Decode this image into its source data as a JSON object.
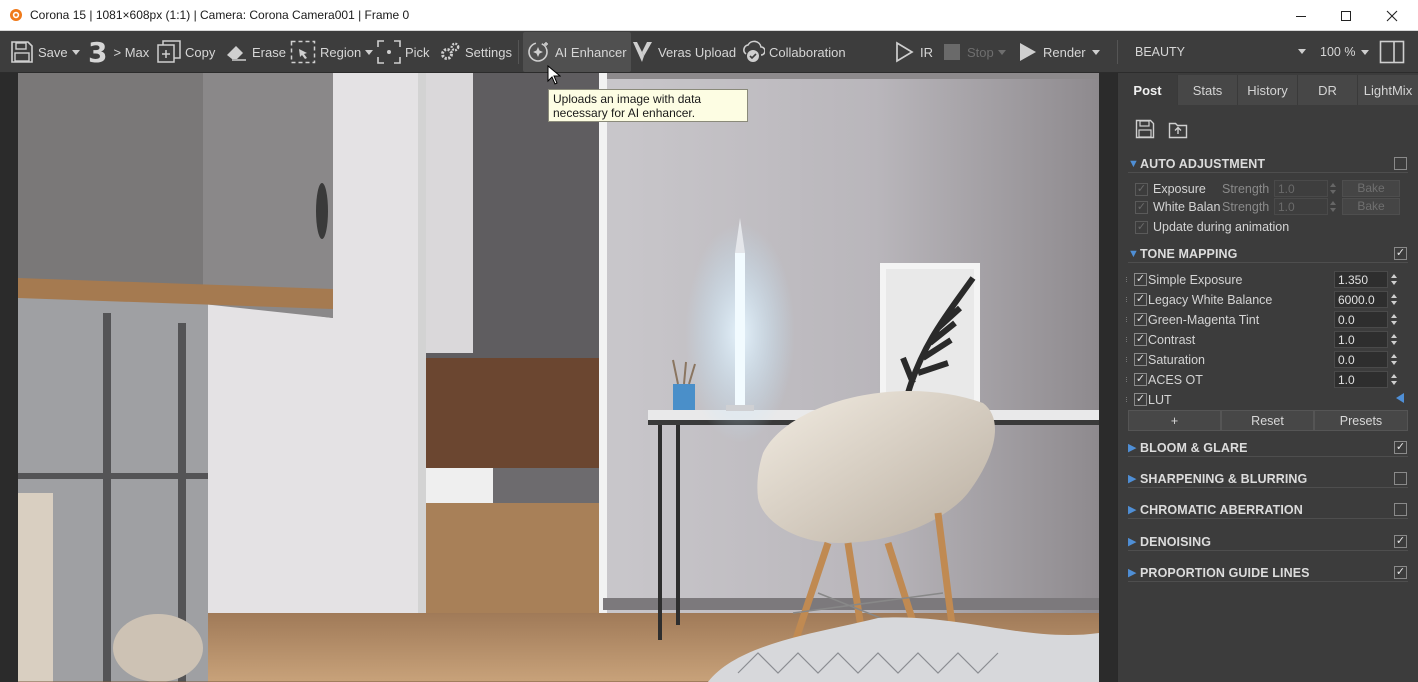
{
  "window": {
    "title": "Corona 15 | 1081×608px (1:1) | Camera: Corona Camera001 | Frame 0",
    "controls": [
      "minimize",
      "maximize",
      "close"
    ]
  },
  "toolbar": {
    "save": "Save",
    "max": "> Max",
    "max_icon_text": "3",
    "copy": "Copy",
    "erase": "Erase",
    "region": "Region",
    "pick": "Pick",
    "settings": "Settings",
    "ai_enhancer": "AI Enhancer",
    "veras_upload": "Veras Upload",
    "collaboration": "Collaboration",
    "ir": "IR",
    "stop": "Stop",
    "render": "Render",
    "pass": "BEAUTY",
    "zoom": "100 %"
  },
  "tooltip": {
    "line1": "Uploads an image with data",
    "line2": "necessary for AI enhancer."
  },
  "panel": {
    "tabs": [
      {
        "label": "Post",
        "active": true
      },
      {
        "label": "Stats",
        "active": false
      },
      {
        "label": "History",
        "active": false
      },
      {
        "label": "DR",
        "active": false
      },
      {
        "label": "LightMix",
        "active": false
      }
    ],
    "auto_adjustment": {
      "title": "AUTO ADJUSTMENT",
      "enabled": false,
      "rows": [
        {
          "label": "Exposure",
          "strength_label": "Strength",
          "value": "1.0",
          "bake": "Bake"
        },
        {
          "label": "White Balan",
          "strength_label": "Strength",
          "value": "1.0",
          "bake": "Bake"
        }
      ],
      "update_label": "Update during animation"
    },
    "tone_mapping": {
      "title": "TONE MAPPING",
      "enabled": true,
      "rows": [
        {
          "label": "Simple Exposure",
          "value": "1.350"
        },
        {
          "label": "Legacy White Balance",
          "value": "6000.0"
        },
        {
          "label": "Green-Magenta Tint",
          "value": "0.0"
        },
        {
          "label": "Contrast",
          "value": "1.0"
        },
        {
          "label": "Saturation",
          "value": "0.0"
        },
        {
          "label": "ACES OT",
          "value": "1.0"
        }
      ],
      "lut_label": "LUT",
      "buttons": {
        "add": "+",
        "reset": "Reset",
        "presets": "Presets"
      }
    },
    "sections": [
      {
        "title": "BLOOM & GLARE",
        "enabled": true
      },
      {
        "title": "SHARPENING & BLURRING",
        "enabled": false
      },
      {
        "title": "CHROMATIC ABERRATION",
        "enabled": false
      },
      {
        "title": "DENOISING",
        "enabled": true
      },
      {
        "title": "PROPORTION GUIDE LINES",
        "enabled": true
      }
    ]
  },
  "colors": {
    "accent": "#4f8fd6",
    "toolbar_bg": "#3d3d3d",
    "panel_bg": "#3c3c3c"
  }
}
